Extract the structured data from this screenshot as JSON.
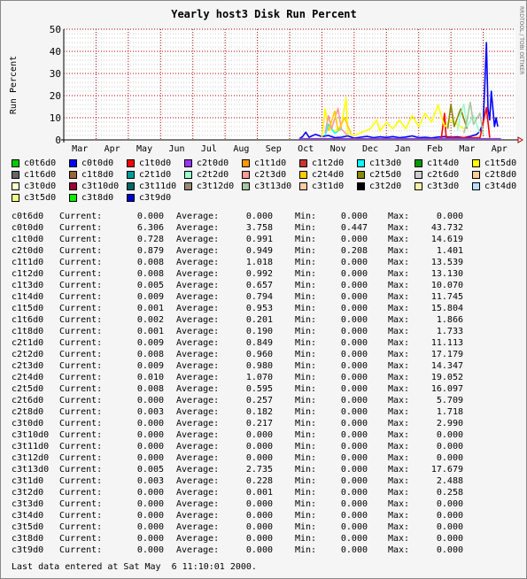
{
  "chart_data": {
    "type": "line",
    "title": "Yearly host3 Disk Run Percent",
    "ylabel": "Run Percent",
    "side_label": "RRDTOOL / TOBI OETIKER",
    "ylim": [
      0,
      50
    ],
    "yticks": [
      "0",
      "10",
      "20",
      "30",
      "40",
      "50"
    ],
    "categories": [
      "Mar",
      "Apr",
      "May",
      "Jun",
      "Jul",
      "Aug",
      "Sep",
      "Oct",
      "Nov",
      "Dec",
      "Jan",
      "Feb",
      "Mar",
      "Apr"
    ],
    "x_domain": [
      0,
      14
    ],
    "grid": true,
    "series": [
      {
        "name": "c0t6d0",
        "color": "#00cc00",
        "points": []
      },
      {
        "name": "c0t0d0",
        "color": "#0000ff",
        "points": [
          [
            7.3,
            0.5
          ],
          [
            7.4,
            1.5
          ],
          [
            7.5,
            3.5
          ],
          [
            7.6,
            1.2
          ],
          [
            7.8,
            2.5
          ],
          [
            8.0,
            1.5
          ],
          [
            8.2,
            2.0
          ],
          [
            8.4,
            1.0
          ],
          [
            8.6,
            1.2
          ],
          [
            8.8,
            1.8
          ],
          [
            9.0,
            0.8
          ],
          [
            9.2,
            1.2
          ],
          [
            9.4,
            1.6
          ],
          [
            9.6,
            1.0
          ],
          [
            9.8,
            1.4
          ],
          [
            10.0,
            1.1
          ],
          [
            10.2,
            1.5
          ],
          [
            10.4,
            1.0
          ],
          [
            10.6,
            1.3
          ],
          [
            10.8,
            1.8
          ],
          [
            11.0,
            1.0
          ],
          [
            11.2,
            1.2
          ],
          [
            11.4,
            0.9
          ],
          [
            11.6,
            1.3
          ],
          [
            11.8,
            1.5
          ],
          [
            12.0,
            1.2
          ],
          [
            12.2,
            1.4
          ],
          [
            12.4,
            1.0
          ],
          [
            12.6,
            1.6
          ],
          [
            12.8,
            2.5
          ],
          [
            12.9,
            4.0
          ],
          [
            13.0,
            8.0
          ],
          [
            13.05,
            25.0
          ],
          [
            13.1,
            44.0
          ],
          [
            13.15,
            14.0
          ],
          [
            13.2,
            9.0
          ],
          [
            13.25,
            22.0
          ],
          [
            13.3,
            14.0
          ],
          [
            13.35,
            6.0
          ],
          [
            13.4,
            10.0
          ],
          [
            13.45,
            6.0
          ]
        ]
      },
      {
        "name": "c1t0d0",
        "color": "#ff0000",
        "points": [
          [
            11.7,
            0.5
          ],
          [
            11.8,
            12.0
          ],
          [
            11.85,
            1.0
          ],
          [
            12.9,
            1.0
          ],
          [
            13.1,
            14.6
          ],
          [
            13.2,
            1.0
          ]
        ]
      },
      {
        "name": "c1t5d0",
        "color": "#ffff00",
        "points": [
          [
            8.0,
            1.0
          ],
          [
            8.1,
            14.0
          ],
          [
            8.2,
            5.0
          ],
          [
            8.4,
            4.0
          ],
          [
            8.6,
            6.0
          ],
          [
            8.75,
            19.0
          ],
          [
            8.8,
            3.0
          ],
          [
            9.0,
            2.0
          ],
          [
            9.5,
            5.0
          ],
          [
            9.7,
            9.0
          ],
          [
            9.8,
            4.0
          ],
          [
            10.0,
            8.0
          ],
          [
            10.2,
            5.0
          ],
          [
            10.4,
            9.0
          ],
          [
            10.6,
            5.0
          ],
          [
            10.8,
            11.0
          ],
          [
            11.0,
            6.0
          ],
          [
            11.2,
            12.0
          ],
          [
            11.4,
            8.0
          ],
          [
            11.6,
            15.8
          ],
          [
            11.8,
            6.0
          ],
          [
            12.0,
            9.0
          ],
          [
            12.2,
            7.0
          ],
          [
            12.4,
            5.0
          ]
        ]
      },
      {
        "name": "c1t3d0",
        "color": "#00ffff",
        "points": [
          [
            8.1,
            2.0
          ],
          [
            8.2,
            7.0
          ],
          [
            8.4,
            3.0
          ],
          [
            8.6,
            5.0
          ],
          [
            8.8,
            2.0
          ]
        ]
      },
      {
        "name": "c2t3d0",
        "color": "#ff9999",
        "points": [
          [
            8.1,
            3.0
          ],
          [
            8.2,
            11.0
          ],
          [
            8.3,
            5.0
          ],
          [
            8.5,
            14.3
          ],
          [
            8.6,
            5.0
          ],
          [
            8.8,
            2.0
          ]
        ]
      },
      {
        "name": "c2t4d0",
        "color": "#ffcc00",
        "points": [
          [
            8.2,
            4.0
          ],
          [
            8.4,
            13.0
          ],
          [
            8.5,
            4.0
          ],
          [
            8.7,
            10.0
          ],
          [
            8.9,
            3.0
          ]
        ]
      },
      {
        "name": "c2t5d0",
        "color": "#888800",
        "points": [
          [
            11.9,
            5.0
          ],
          [
            12.0,
            16.0
          ],
          [
            12.1,
            6.0
          ],
          [
            12.3,
            14.0
          ],
          [
            12.5,
            5.0
          ]
        ]
      },
      {
        "name": "c2t2d0",
        "color": "#99ffcc",
        "points": [
          [
            12.2,
            4.0
          ],
          [
            12.3,
            12.0
          ],
          [
            12.4,
            16.0
          ],
          [
            12.5,
            6.0
          ],
          [
            12.7,
            11.0
          ],
          [
            12.9,
            3.0
          ]
        ]
      },
      {
        "name": "c3t13d0",
        "color": "#a8c8a0",
        "points": [
          [
            12.4,
            3.0
          ],
          [
            12.5,
            9.0
          ],
          [
            12.6,
            17.0
          ],
          [
            12.7,
            7.0
          ],
          [
            12.9,
            12.0
          ],
          [
            13.0,
            2.0
          ]
        ]
      }
    ]
  },
  "legend": [
    [
      {
        "label": "c0t6d0",
        "color": "#00cc00"
      },
      {
        "label": "c0t0d0",
        "color": "#0000ff"
      },
      {
        "label": "c1t0d0",
        "color": "#ff0000"
      },
      {
        "label": "c2t0d0",
        "color": "#9933ff"
      },
      {
        "label": "c1t1d0",
        "color": "#ff9900"
      },
      {
        "label": "c1t2d0",
        "color": "#cc3333"
      },
      {
        "label": "c1t3d0",
        "color": "#00ffff"
      },
      {
        "label": "c1t4d0",
        "color": "#009900"
      },
      {
        "label": "c1t5d0",
        "color": "#ffff00"
      }
    ],
    [
      {
        "label": "c1t6d0",
        "color": "#666666"
      },
      {
        "label": "c1t8d0",
        "color": "#996633"
      },
      {
        "label": "c2t1d0",
        "color": "#009999"
      },
      {
        "label": "c2t2d0",
        "color": "#99ffcc"
      },
      {
        "label": "c2t3d0",
        "color": "#ff9999"
      },
      {
        "label": "c2t4d0",
        "color": "#ffcc00"
      },
      {
        "label": "c2t5d0",
        "color": "#888800"
      },
      {
        "label": "c2t6d0",
        "color": "#cccccc"
      },
      {
        "label": "c2t8d0",
        "color": "#ffcc99"
      }
    ],
    [
      {
        "label": "c3t0d0",
        "color": "#ffffcc"
      },
      {
        "label": "c3t10d0",
        "color": "#990033"
      },
      {
        "label": "c3t11d0",
        "color": "#006666"
      },
      {
        "label": "c3t12d0",
        "color": "#998877"
      },
      {
        "label": "c3t13d0",
        "color": "#a8c8a0"
      },
      {
        "label": "c3t1d0",
        "color": "#ffccaa"
      },
      {
        "label": "c3t2d0",
        "color": "#000000"
      },
      {
        "label": "c3t3d0",
        "color": "#ffeeaa"
      },
      {
        "label": "c3t4d0",
        "color": "#bbddff"
      }
    ],
    [
      {
        "label": "c3t5d0",
        "color": "#eeff88"
      },
      {
        "label": "c3t8d0",
        "color": "#00ee00"
      },
      {
        "label": "c3t9d0",
        "color": "#0000cc"
      }
    ]
  ],
  "stats_labels": {
    "current": "Current:",
    "average": "Average:",
    "min": "Min:",
    "max": "Max:"
  },
  "stats": [
    {
      "name": "c0t6d0",
      "current": "0.000",
      "average": "0.000",
      "min": "0.000",
      "max": "0.000"
    },
    {
      "name": "c0t0d0",
      "current": "6.306",
      "average": "3.758",
      "min": "0.447",
      "max": "43.732"
    },
    {
      "name": "c1t0d0",
      "current": "0.728",
      "average": "0.991",
      "min": "0.000",
      "max": "14.619"
    },
    {
      "name": "c2t0d0",
      "current": "0.879",
      "average": "0.949",
      "min": "0.208",
      "max": "1.401"
    },
    {
      "name": "c1t1d0",
      "current": "0.008",
      "average": "1.018",
      "min": "0.000",
      "max": "13.539"
    },
    {
      "name": "c1t2d0",
      "current": "0.008",
      "average": "0.992",
      "min": "0.000",
      "max": "13.130"
    },
    {
      "name": "c1t3d0",
      "current": "0.005",
      "average": "0.657",
      "min": "0.000",
      "max": "10.070"
    },
    {
      "name": "c1t4d0",
      "current": "0.009",
      "average": "0.794",
      "min": "0.000",
      "max": "11.745"
    },
    {
      "name": "c1t5d0",
      "current": "0.001",
      "average": "0.953",
      "min": "0.000",
      "max": "15.804"
    },
    {
      "name": "c1t6d0",
      "current": "0.002",
      "average": "0.201",
      "min": "0.000",
      "max": "1.866"
    },
    {
      "name": "c1t8d0",
      "current": "0.001",
      "average": "0.190",
      "min": "0.000",
      "max": "1.733"
    },
    {
      "name": "c2t1d0",
      "current": "0.009",
      "average": "0.849",
      "min": "0.000",
      "max": "11.113"
    },
    {
      "name": "c2t2d0",
      "current": "0.008",
      "average": "0.960",
      "min": "0.000",
      "max": "17.179"
    },
    {
      "name": "c2t3d0",
      "current": "0.009",
      "average": "0.980",
      "min": "0.000",
      "max": "14.347"
    },
    {
      "name": "c2t4d0",
      "current": "0.010",
      "average": "1.070",
      "min": "0.000",
      "max": "19.052"
    },
    {
      "name": "c2t5d0",
      "current": "0.008",
      "average": "0.595",
      "min": "0.000",
      "max": "16.097"
    },
    {
      "name": "c2t6d0",
      "current": "0.000",
      "average": "0.257",
      "min": "0.000",
      "max": "5.709"
    },
    {
      "name": "c2t8d0",
      "current": "0.003",
      "average": "0.182",
      "min": "0.000",
      "max": "1.718"
    },
    {
      "name": "c3t0d0",
      "current": "0.000",
      "average": "0.217",
      "min": "0.000",
      "max": "2.990"
    },
    {
      "name": "c3t10d0",
      "current": "0.000",
      "average": "0.000",
      "min": "0.000",
      "max": "0.000"
    },
    {
      "name": "c3t11d0",
      "current": "0.000",
      "average": "0.000",
      "min": "0.000",
      "max": "0.000"
    },
    {
      "name": "c3t12d0",
      "current": "0.000",
      "average": "0.000",
      "min": "0.000",
      "max": "0.000"
    },
    {
      "name": "c3t13d0",
      "current": "0.005",
      "average": "2.735",
      "min": "0.000",
      "max": "17.679"
    },
    {
      "name": "c3t1d0",
      "current": "0.003",
      "average": "0.228",
      "min": "0.000",
      "max": "2.488"
    },
    {
      "name": "c3t2d0",
      "current": "0.000",
      "average": "0.001",
      "min": "0.000",
      "max": "0.258"
    },
    {
      "name": "c3t3d0",
      "current": "0.000",
      "average": "0.000",
      "min": "0.000",
      "max": "0.000"
    },
    {
      "name": "c3t4d0",
      "current": "0.000",
      "average": "0.000",
      "min": "0.000",
      "max": "0.000"
    },
    {
      "name": "c3t5d0",
      "current": "0.000",
      "average": "0.000",
      "min": "0.000",
      "max": "0.000"
    },
    {
      "name": "c3t8d0",
      "current": "0.000",
      "average": "0.000",
      "min": "0.000",
      "max": "0.000"
    },
    {
      "name": "c3t9d0",
      "current": "0.000",
      "average": "0.000",
      "min": "0.000",
      "max": "0.000"
    }
  ],
  "footer": "Last data entered at Sat May  6 11:10:01 2000."
}
